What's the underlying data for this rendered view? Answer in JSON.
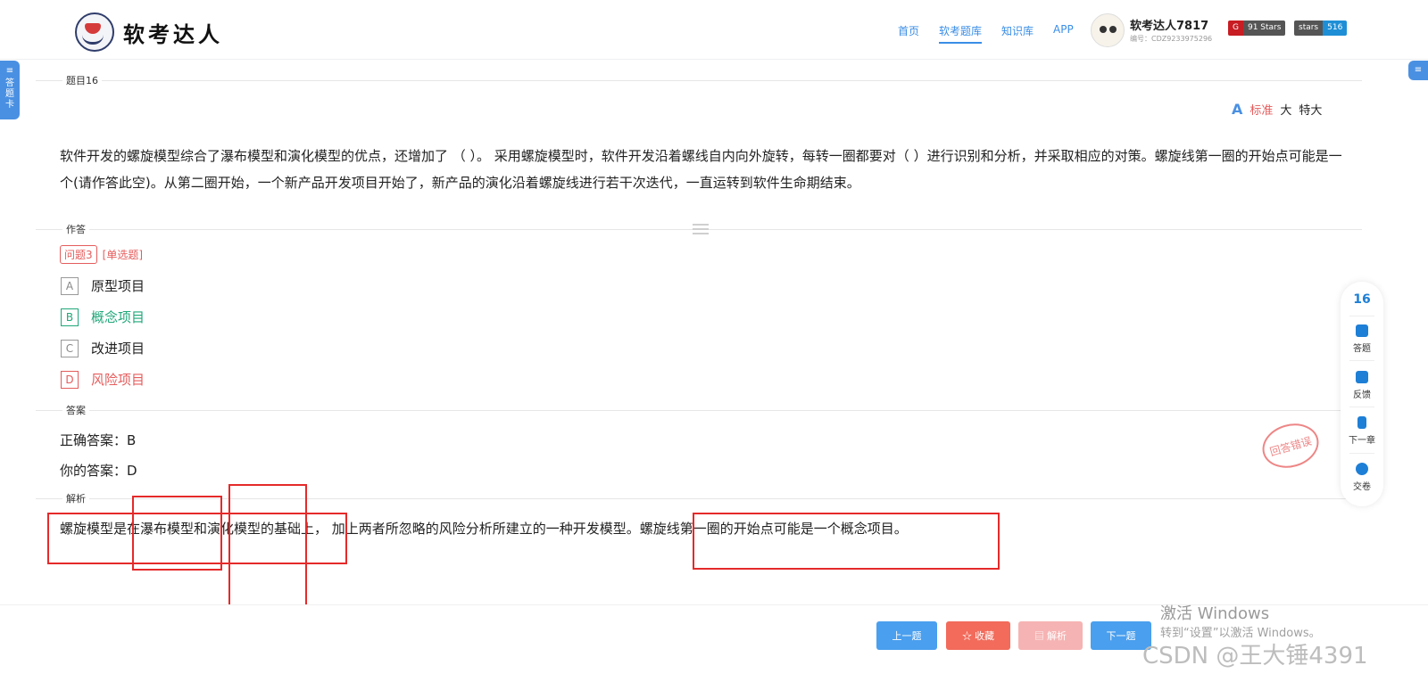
{
  "header": {
    "logo_text": "软考达人",
    "nav": [
      "首页",
      "软考题库",
      "知识库",
      "APP"
    ],
    "nav_active": "软考题库",
    "user_name": "软考达人7817",
    "user_id": "编号：CDZ9233975296",
    "badge_gitee": "91 Stars",
    "badge_github_label": "stars",
    "badge_github_count": "516"
  },
  "side_tab": "答题卡",
  "sections": {
    "question_title": "题目16",
    "answer_section": "作答",
    "answer_key": "答案",
    "analysis": "解析"
  },
  "font_sizes": [
    "标准",
    "大",
    "特大"
  ],
  "question": {
    "text": "软件开发的螺旋模型综合了瀑布模型和演化模型的优点，还增加了 （ ）。 采用螺旋模型时，软件开发沿着螺线自内向外旋转，每转一圈都要对（ ）进行识别和分析，并采取相应的对策。螺旋线第一圈的开始点可能是一个(请作答此空)。从第二圈开始，一个新产品开发项目开始了，新产品的演化沿着螺旋线进行若干次迭代，一直运转到软件生命期结束。",
    "tag_num": "问题3",
    "tag_type": "[单选题]",
    "options": [
      {
        "letter": "A",
        "text": "原型项目"
      },
      {
        "letter": "B",
        "text": "概念项目"
      },
      {
        "letter": "C",
        "text": "改进项目"
      },
      {
        "letter": "D",
        "text": "风险项目"
      }
    ]
  },
  "answers": {
    "correct": "正确答案：B",
    "yours": "你的答案：D"
  },
  "analysis_text": "螺旋模型是在瀑布模型和演化模型的基础上， 加上两者所忽略的风险分析所建立的一种开发模型。螺旋线第一圈的开始点可能是一个概念项目。",
  "stamp": "回答错误",
  "float_bar": {
    "number": "16",
    "items": [
      "答题",
      "反馈",
      "下一章",
      "交卷"
    ]
  },
  "buttons": {
    "prev": "上一题",
    "fav": "☆ 收藏",
    "analysis": "▤ 解析",
    "next": "下一题"
  },
  "watermark": {
    "win1": "激活 Windows",
    "win2": "转到“设置”以激活 Windows。",
    "csdn": "CSDN @王大锤4391"
  },
  "colors": {
    "accent": "#3a8ee6",
    "correct": "#20a77a",
    "wrong": "#e55c5c",
    "fav_button": "#f26b5b",
    "analysis_button": "#f6b3b3"
  }
}
